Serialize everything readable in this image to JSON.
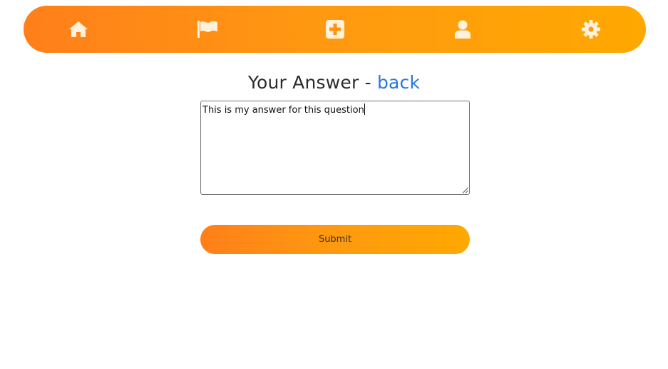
{
  "nav": {
    "items": [
      {
        "icon": "home-icon"
      },
      {
        "icon": "flag-icon"
      },
      {
        "icon": "plus-square-icon"
      },
      {
        "icon": "user-icon"
      },
      {
        "icon": "gear-icon"
      }
    ],
    "gradient_colors": [
      "#ff7f1a",
      "#ffa800"
    ],
    "icon_color": "#fff1dc"
  },
  "heading": {
    "title": "Your Answer - ",
    "back_link": "back",
    "link_color": "#2a79d6"
  },
  "answer": {
    "value": "This is my answer for this question"
  },
  "submit": {
    "label": "Submit"
  }
}
